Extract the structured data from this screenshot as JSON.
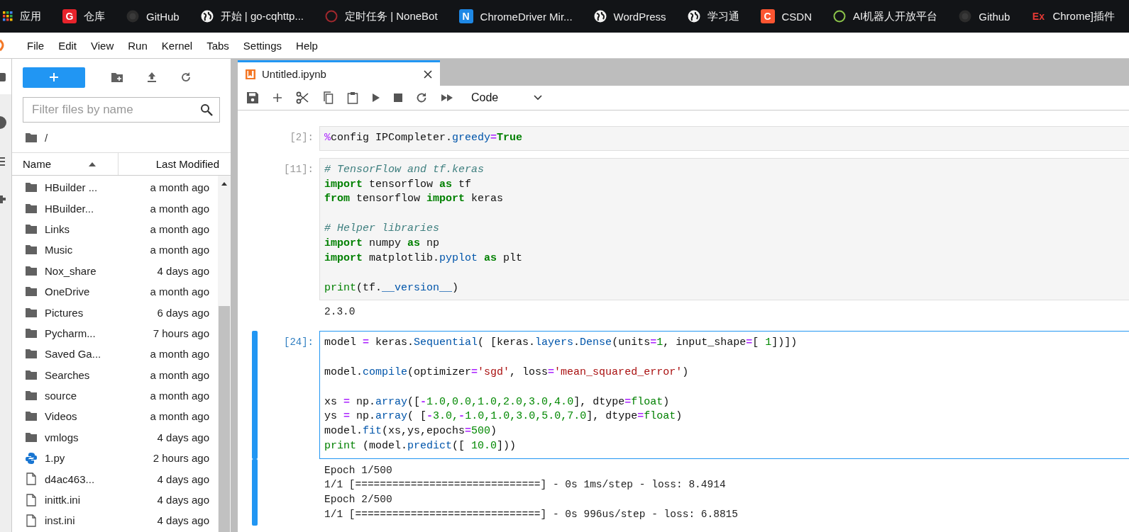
{
  "bookmarks": [
    {
      "label": "应用",
      "kind": "apps"
    },
    {
      "label": "仓库",
      "kind": "letter",
      "logo_text": "G",
      "color": "#e8232b"
    },
    {
      "label": "GitHub",
      "kind": "github"
    },
    {
      "label": "开始 | go-cqhttp...",
      "kind": "globe"
    },
    {
      "label": "定时任务 | NoneBot",
      "kind": "ring",
      "color": "#a0282d"
    },
    {
      "label": "ChromeDriver Mir...",
      "kind": "letter",
      "logo_text": "N",
      "color": "#1e88e5"
    },
    {
      "label": "WordPress",
      "kind": "globe"
    },
    {
      "label": "学习通",
      "kind": "globe"
    },
    {
      "label": "CSDN",
      "kind": "letter",
      "logo_text": "C",
      "color": "#fc5531"
    },
    {
      "label": "AI机器人开放平台",
      "kind": "ring",
      "color": "#8bc34a"
    },
    {
      "label": "Github",
      "kind": "github"
    },
    {
      "label": "Chrome]插件",
      "kind": "letter",
      "logo_text": "Ex",
      "color": "#e53935"
    }
  ],
  "menu": [
    "File",
    "Edit",
    "View",
    "Run",
    "Kernel",
    "Tabs",
    "Settings",
    "Help"
  ],
  "file_browser": {
    "filter_placeholder": "Filter files by name",
    "path": "/",
    "columns": [
      "Name",
      "Last Modified"
    ],
    "rows": [
      {
        "name": "HBuilder ...",
        "modified": "a month ago",
        "kind": "folder"
      },
      {
        "name": "HBuilder...",
        "modified": "a month ago",
        "kind": "folder"
      },
      {
        "name": "Links",
        "modified": "a month ago",
        "kind": "folder"
      },
      {
        "name": "Music",
        "modified": "a month ago",
        "kind": "folder"
      },
      {
        "name": "Nox_share",
        "modified": "4 days ago",
        "kind": "folder"
      },
      {
        "name": "OneDrive",
        "modified": "a month ago",
        "kind": "folder"
      },
      {
        "name": "Pictures",
        "modified": "6 days ago",
        "kind": "folder"
      },
      {
        "name": "Pycharm...",
        "modified": "7 hours ago",
        "kind": "folder"
      },
      {
        "name": "Saved Ga...",
        "modified": "a month ago",
        "kind": "folder"
      },
      {
        "name": "Searches",
        "modified": "a month ago",
        "kind": "folder"
      },
      {
        "name": "source",
        "modified": "a month ago",
        "kind": "folder"
      },
      {
        "name": "Videos",
        "modified": "a month ago",
        "kind": "folder"
      },
      {
        "name": "vmlogs",
        "modified": "4 days ago",
        "kind": "folder"
      },
      {
        "name": "1.py",
        "modified": "2 hours ago",
        "kind": "python"
      },
      {
        "name": "d4ac463...",
        "modified": "4 days ago",
        "kind": "file"
      },
      {
        "name": "inittk.ini",
        "modified": "4 days ago",
        "kind": "file"
      },
      {
        "name": "inst.ini",
        "modified": "4 days ago",
        "kind": "file"
      }
    ]
  },
  "notebook": {
    "tab": {
      "title": "Untitled.ipynb"
    },
    "cell_type": "Code",
    "cells": [
      {
        "prompt": "[2]:",
        "selected": false,
        "blocks": [
          [
            [
              {
                "text": "%",
                "kind": "magic"
              },
              {
                "text": "config IPCompleter.",
                "kind": "plain"
              },
              {
                "text": "greedy",
                "kind": "prop"
              },
              {
                "text": "=",
                "kind": "op"
              },
              {
                "text": "True",
                "kind": "kw"
              }
            ]
          ]
        ]
      },
      {
        "prompt": "[11]:",
        "selected": false,
        "blocks": [
          [
            [
              {
                "text": "# TensorFlow and tf.keras",
                "kind": "comment"
              }
            ],
            [
              {
                "text": "import",
                "kind": "kw"
              },
              {
                "text": " tensorflow ",
                "kind": "plain"
              },
              {
                "text": "as",
                "kind": "kw"
              },
              {
                "text": " tf",
                "kind": "plain"
              }
            ],
            [
              {
                "text": "from",
                "kind": "kw"
              },
              {
                "text": " tensorflow ",
                "kind": "plain"
              },
              {
                "text": "import",
                "kind": "kw"
              },
              {
                "text": " keras",
                "kind": "plain"
              }
            ]
          ],
          [
            [
              {
                "text": "# Helper libraries",
                "kind": "comment"
              }
            ],
            [
              {
                "text": "import",
                "kind": "kw"
              },
              {
                "text": " numpy ",
                "kind": "plain"
              },
              {
                "text": "as",
                "kind": "kw"
              },
              {
                "text": " np",
                "kind": "plain"
              }
            ],
            [
              {
                "text": "import",
                "kind": "kw"
              },
              {
                "text": " matplotlib.",
                "kind": "plain"
              },
              {
                "text": "pyplot",
                "kind": "prop"
              },
              {
                "text": " as",
                "kind": "kw"
              },
              {
                "text": " plt",
                "kind": "plain"
              }
            ]
          ],
          [
            [
              {
                "text": "print",
                "kind": "builtin"
              },
              {
                "text": "(tf.",
                "kind": "plain"
              },
              {
                "text": "__version__",
                "kind": "prop"
              },
              {
                "text": ")",
                "kind": "plain"
              }
            ]
          ]
        ],
        "output": [
          "2.3.0"
        ]
      },
      {
        "prompt": "[24]:",
        "selected": true,
        "blocks": [
          [
            [
              {
                "text": "model ",
                "kind": "plain"
              },
              {
                "text": "=",
                "kind": "op"
              },
              {
                "text": " keras.",
                "kind": "plain"
              },
              {
                "text": "Sequential",
                "kind": "prop"
              },
              {
                "text": "( [keras.",
                "kind": "plain"
              },
              {
                "text": "layers",
                "kind": "prop"
              },
              {
                "text": ".",
                "kind": "plain"
              },
              {
                "text": "Dense",
                "kind": "prop"
              },
              {
                "text": "(units",
                "kind": "plain"
              },
              {
                "text": "=",
                "kind": "op"
              },
              {
                "text": "1",
                "kind": "num"
              },
              {
                "text": ", input_shape",
                "kind": "plain"
              },
              {
                "text": "=",
                "kind": "op"
              },
              {
                "text": "[ ",
                "kind": "plain"
              },
              {
                "text": "1",
                "kind": "num"
              },
              {
                "text": "])])",
                "kind": "plain"
              }
            ]
          ],
          [
            [
              {
                "text": "model.",
                "kind": "plain"
              },
              {
                "text": "compile",
                "kind": "prop"
              },
              {
                "text": "(optimizer",
                "kind": "plain"
              },
              {
                "text": "=",
                "kind": "op"
              },
              {
                "text": "'sgd'",
                "kind": "str"
              },
              {
                "text": ", loss",
                "kind": "plain"
              },
              {
                "text": "=",
                "kind": "op"
              },
              {
                "text": "'mean_squared_error'",
                "kind": "str"
              },
              {
                "text": ")",
                "kind": "plain"
              }
            ]
          ],
          [
            [
              {
                "text": "xs ",
                "kind": "plain"
              },
              {
                "text": "=",
                "kind": "op"
              },
              {
                "text": " np.",
                "kind": "plain"
              },
              {
                "text": "array",
                "kind": "prop"
              },
              {
                "text": "([",
                "kind": "plain"
              },
              {
                "text": "-",
                "kind": "op"
              },
              {
                "text": "1.0,0.0,1.0,2.0,3.0,4.0",
                "kind": "num"
              },
              {
                "text": "], dtype",
                "kind": "plain"
              },
              {
                "text": "=",
                "kind": "op"
              },
              {
                "text": "float",
                "kind": "builtin"
              },
              {
                "text": ")",
                "kind": "plain"
              }
            ],
            [
              {
                "text": "ys ",
                "kind": "plain"
              },
              {
                "text": "=",
                "kind": "op"
              },
              {
                "text": " np.",
                "kind": "plain"
              },
              {
                "text": "array",
                "kind": "prop"
              },
              {
                "text": "( [",
                "kind": "plain"
              },
              {
                "text": "-",
                "kind": "op"
              },
              {
                "text": "3.0,",
                "kind": "num"
              },
              {
                "text": "-",
                "kind": "op"
              },
              {
                "text": "1.0,1.0,3.0,5.0,7.0",
                "kind": "num"
              },
              {
                "text": "], dtype",
                "kind": "plain"
              },
              {
                "text": "=",
                "kind": "op"
              },
              {
                "text": "float",
                "kind": "builtin"
              },
              {
                "text": ")",
                "kind": "plain"
              }
            ],
            [
              {
                "text": "model.",
                "kind": "plain"
              },
              {
                "text": "fit",
                "kind": "prop"
              },
              {
                "text": "(xs,ys,epochs",
                "kind": "plain"
              },
              {
                "text": "=",
                "kind": "op"
              },
              {
                "text": "500",
                "kind": "num"
              },
              {
                "text": ")",
                "kind": "plain"
              }
            ],
            [
              {
                "text": "print",
                "kind": "builtin"
              },
              {
                "text": " (model.",
                "kind": "plain"
              },
              {
                "text": "predict",
                "kind": "prop"
              },
              {
                "text": "([ ",
                "kind": "plain"
              },
              {
                "text": "10.0",
                "kind": "num"
              },
              {
                "text": "]))",
                "kind": "plain"
              }
            ]
          ]
        ],
        "output": [
          "Epoch 1/500",
          "1/1 [==============================] - 0s 1ms/step - loss: 8.4914",
          "Epoch 2/500",
          "1/1 [==============================] - 0s 996us/step - loss: 6.8815"
        ]
      }
    ]
  }
}
